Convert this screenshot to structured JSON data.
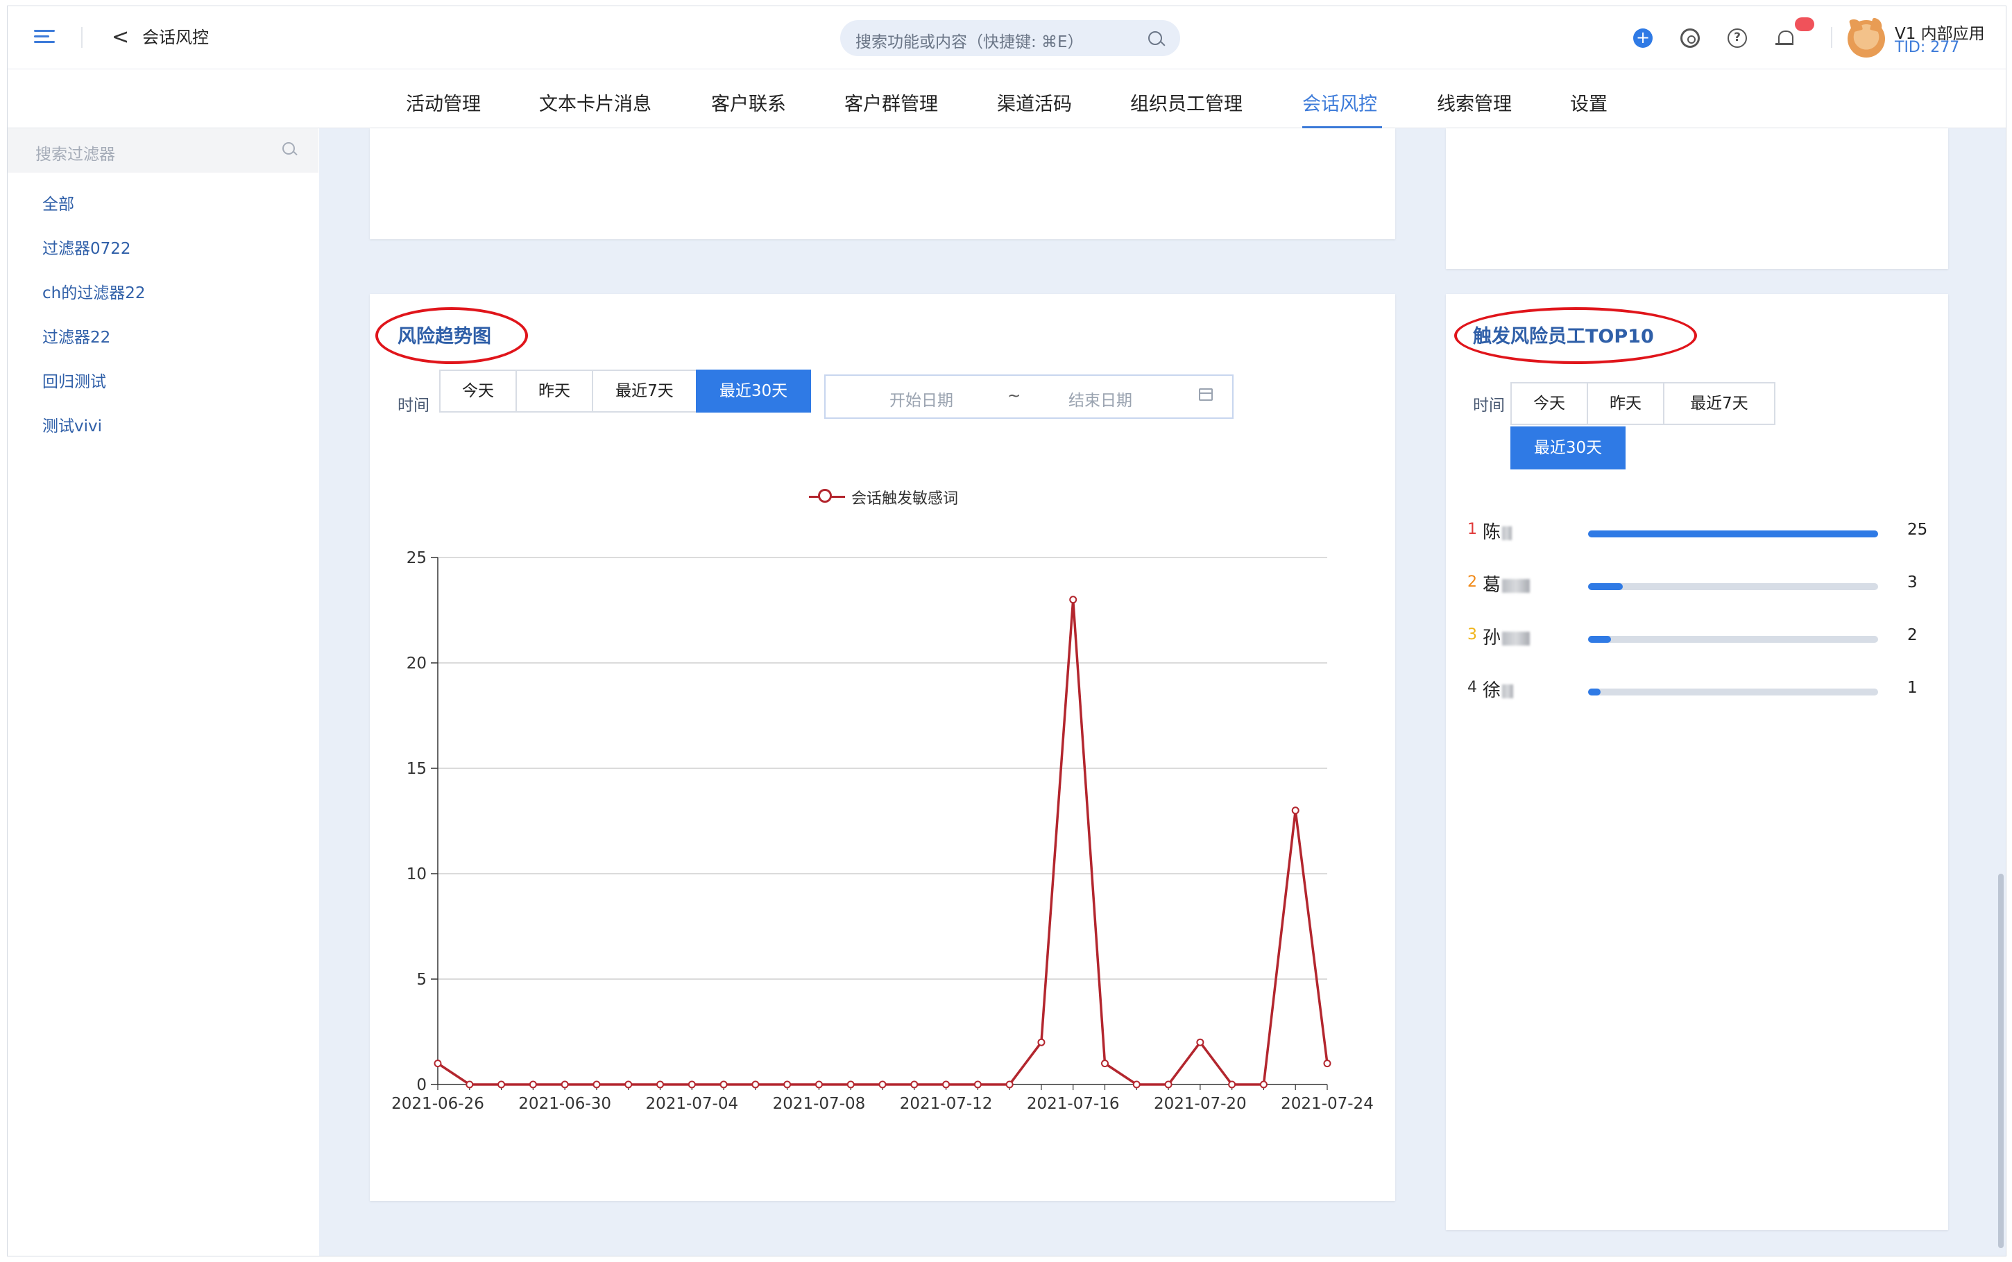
{
  "header": {
    "back_label": "<",
    "title": "会话风控",
    "search_placeholder": "搜索功能或内容（快捷键: ⌘E）",
    "user_name": "V1 内部应用",
    "user_tid": "TID: 277"
  },
  "nav": {
    "tabs": [
      "活动管理",
      "文本卡片消息",
      "客户联系",
      "客户群管理",
      "渠道活码",
      "组织员工管理",
      "会话风控",
      "线索管理",
      "设置"
    ],
    "active": "会话风控"
  },
  "sidebar": {
    "search_placeholder": "搜索过滤器",
    "items": [
      "全部",
      "过滤器0722",
      "ch的过滤器22",
      "过滤器22",
      "回归测试",
      "测试vivi"
    ]
  },
  "risk_trend": {
    "title": "风险趋势图",
    "time_label": "时间",
    "ranges": [
      "今天",
      "昨天",
      "最近7天",
      "最近30天"
    ],
    "active_range": "最近30天",
    "start_placeholder": "开始日期",
    "separator": "~",
    "end_placeholder": "结束日期"
  },
  "top10": {
    "title": "触发风险员工TOP10",
    "time_label": "时间",
    "ranges": [
      "今天",
      "昨天",
      "最近7天",
      "最近30天"
    ],
    "active_range": "最近30天",
    "rows": [
      {
        "rank": "1",
        "name": "陈",
        "count": 25,
        "rank_color": "#e03a3a"
      },
      {
        "rank": "2",
        "name": "葛",
        "count": 3,
        "rank_color": "#f08a1a"
      },
      {
        "rank": "3",
        "name": "孙",
        "count": 2,
        "rank_color": "#f0b41a"
      },
      {
        "rank": "4",
        "name": "徐",
        "count": 1,
        "rank_color": "#333333"
      }
    ],
    "max": 25
  },
  "chart_data": {
    "type": "line",
    "title": "",
    "xlabel": "",
    "ylabel": "",
    "ylim": [
      0,
      25
    ],
    "yticks": [
      0,
      5,
      10,
      15,
      20,
      25
    ],
    "grid": true,
    "legend_position": "top-center",
    "series": [
      {
        "name": "会话触发敏感词",
        "color": "#b3262e",
        "values": [
          1,
          0,
          0,
          0,
          0,
          0,
          0,
          0,
          0,
          0,
          0,
          0,
          0,
          0,
          0,
          0,
          0,
          0,
          0,
          2,
          23,
          1,
          0,
          0,
          2,
          0,
          0,
          13,
          1
        ]
      }
    ],
    "x": [
      "2021-06-26",
      "2021-06-27",
      "2021-06-28",
      "2021-06-29",
      "2021-06-30",
      "2021-07-01",
      "2021-07-02",
      "2021-07-03",
      "2021-07-04",
      "2021-07-05",
      "2021-07-06",
      "2021-07-07",
      "2021-07-08",
      "2021-07-09",
      "2021-07-10",
      "2021-07-11",
      "2021-07-12",
      "2021-07-13",
      "2021-07-14",
      "2021-07-15",
      "2021-07-16",
      "2021-07-17",
      "2021-07-18",
      "2021-07-19",
      "2021-07-20",
      "2021-07-21",
      "2021-07-22",
      "2021-07-23",
      "2021-07-24"
    ],
    "xtick_labels": [
      "2021-06-26",
      "2021-06-30",
      "2021-07-04",
      "2021-07-08",
      "2021-07-12",
      "2021-07-16",
      "2021-07-20",
      "2021-07-24"
    ]
  }
}
